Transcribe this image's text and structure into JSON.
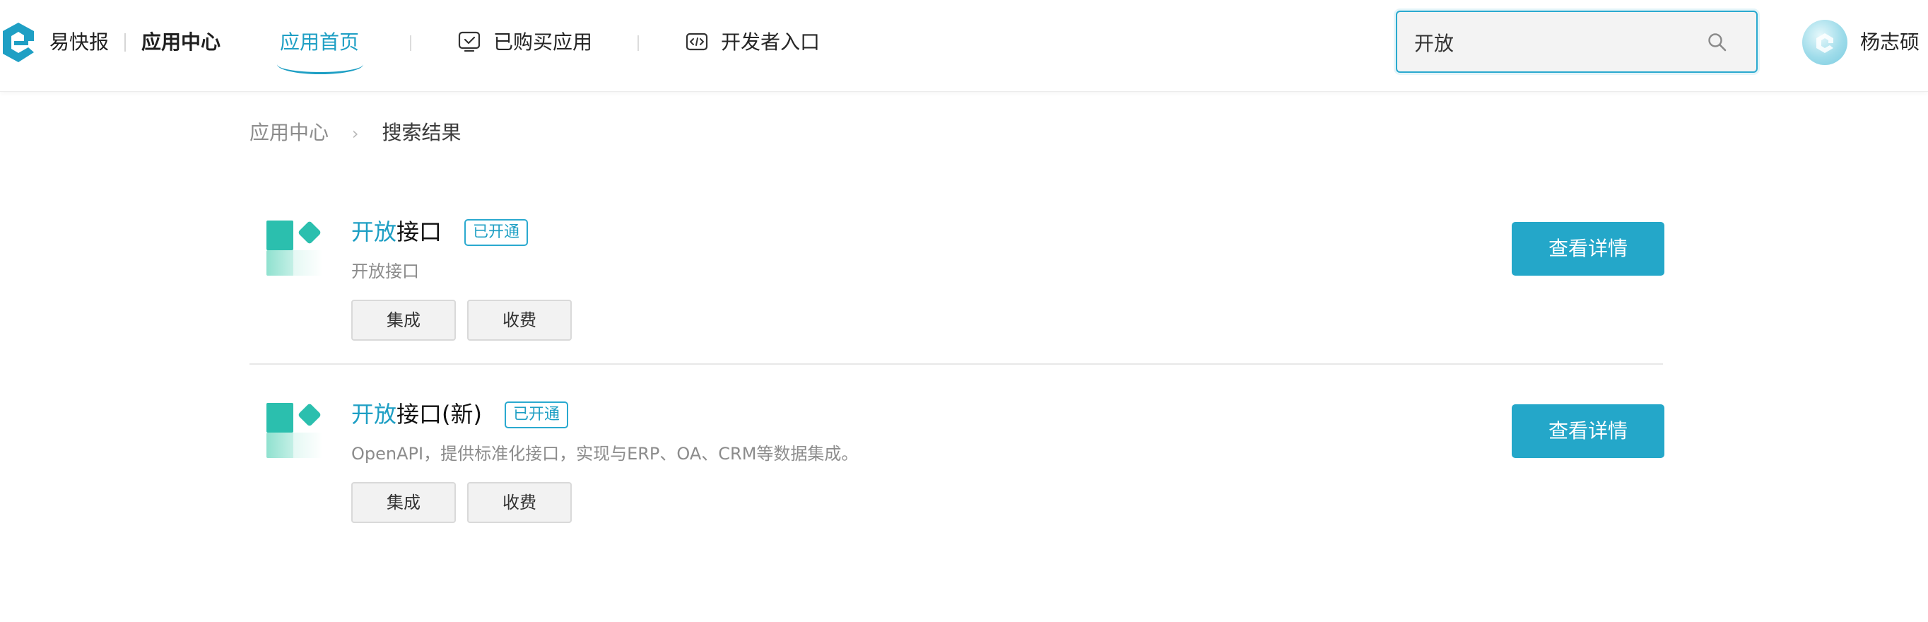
{
  "header": {
    "brand_name": "易快报",
    "brand_center": "应用中心",
    "nav": {
      "home": "应用首页",
      "purchased": "已购买应用",
      "developer": "开发者入口"
    },
    "search": {
      "value": "开放"
    },
    "user": {
      "name": "杨志硕"
    }
  },
  "breadcrumb": {
    "root": "应用中心",
    "current": "搜索结果"
  },
  "results": [
    {
      "title_highlight": "开放",
      "title_rest": "接口",
      "status": "已开通",
      "description": "开放接口",
      "tags": [
        "集成",
        "收费"
      ],
      "action_label": "查看详情"
    },
    {
      "title_highlight": "开放",
      "title_rest": "接口(新)",
      "status": "已开通",
      "description": "OpenAPI，提供标准化接口，实现与ERP、OA、CRM等数据集成。",
      "tags": [
        "集成",
        "收费"
      ],
      "action_label": "查看详情"
    }
  ],
  "colors": {
    "accent": "#1e9fc4",
    "button": "#24a7c9",
    "logo_teal": "#2bbfae"
  }
}
